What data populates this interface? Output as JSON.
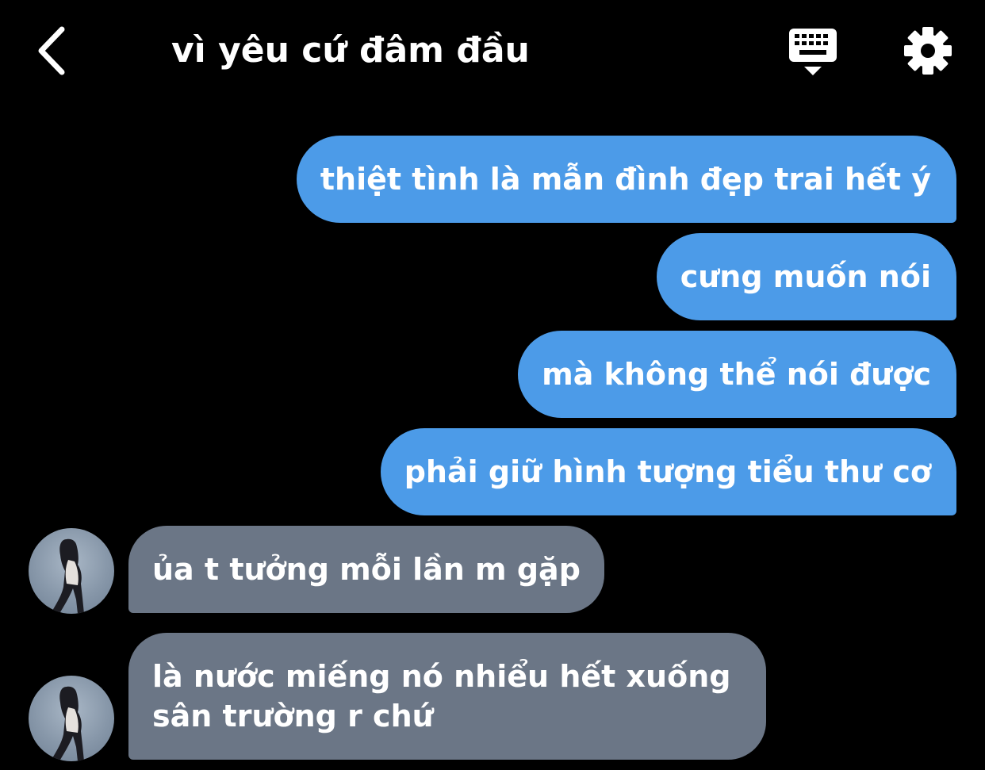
{
  "header": {
    "title": "vì yêu cứ đâm đầu"
  },
  "messages": {
    "sent": [
      "thiệt tình là mẫn đình đẹp trai hết ý",
      "cưng muốn nói",
      "mà không thể nói được",
      "phải giữ hình tượng tiểu thư cơ"
    ],
    "received": [
      "ủa t tưởng mỗi lần m gặp",
      "là nước miếng nó nhiểu hết xuống",
      "sân trường r chứ"
    ]
  },
  "colors": {
    "sent_bubble": "#4c9be8",
    "received_bubble": "#6b7686",
    "background": "#000000"
  },
  "icons": {
    "back": "chevron-left-icon",
    "keyboard": "keyboard-icon",
    "settings": "gear-icon"
  }
}
